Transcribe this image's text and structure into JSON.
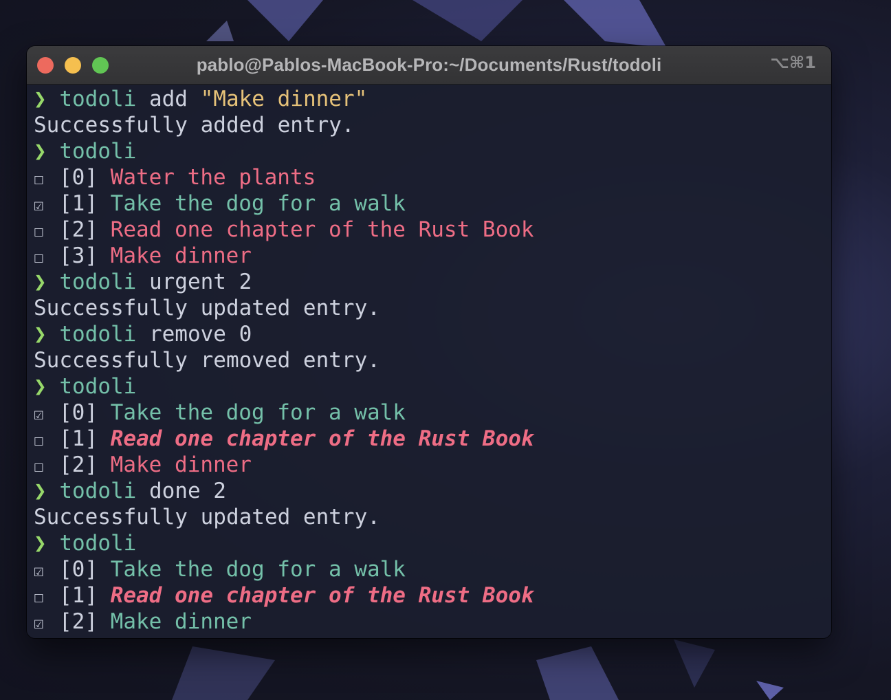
{
  "window": {
    "title": "pablo@Pablos-MacBook-Pro:~/Documents/Rust/todoli",
    "shortcut": "⌥⌘1"
  },
  "colors": {
    "prompt": "#97d86a",
    "command": "#74c0a9",
    "string": "#e6c279",
    "pending": "#ee6d85",
    "done": "#74c0a9",
    "text": "#cdd1de"
  },
  "prompt_symbol": "❯",
  "lines": [
    {
      "kind": "cmd",
      "cmd": "todoli",
      "args": " add ",
      "str": "\"Make dinner\""
    },
    {
      "kind": "out",
      "text": "Successfully added entry."
    },
    {
      "kind": "cmd",
      "cmd": "todoli",
      "args": "",
      "str": ""
    },
    {
      "kind": "item",
      "box": "☐",
      "idx": "[0]",
      "text": "Water the plants",
      "state": "pending"
    },
    {
      "kind": "item",
      "box": "☑",
      "idx": "[1]",
      "text": "Take the dog for a walk",
      "state": "done"
    },
    {
      "kind": "item",
      "box": "☐",
      "idx": "[2]",
      "text": "Read one chapter of the Rust Book",
      "state": "pending"
    },
    {
      "kind": "item",
      "box": "☐",
      "idx": "[3]",
      "text": "Make dinner",
      "state": "pending"
    },
    {
      "kind": "cmd",
      "cmd": "todoli",
      "args": " urgent 2",
      "str": ""
    },
    {
      "kind": "out",
      "text": "Successfully updated entry."
    },
    {
      "kind": "cmd",
      "cmd": "todoli",
      "args": " remove 0",
      "str": ""
    },
    {
      "kind": "out",
      "text": "Successfully removed entry."
    },
    {
      "kind": "cmd",
      "cmd": "todoli",
      "args": "",
      "str": ""
    },
    {
      "kind": "item",
      "box": "☑",
      "idx": "[0]",
      "text": "Take the dog for a walk",
      "state": "done"
    },
    {
      "kind": "item",
      "box": "☐",
      "idx": "[1]",
      "text": "Read one chapter of the Rust Book",
      "state": "urgent"
    },
    {
      "kind": "item",
      "box": "☐",
      "idx": "[2]",
      "text": "Make dinner",
      "state": "pending"
    },
    {
      "kind": "cmd",
      "cmd": "todoli",
      "args": " done 2",
      "str": ""
    },
    {
      "kind": "out",
      "text": "Successfully updated entry."
    },
    {
      "kind": "cmd",
      "cmd": "todoli",
      "args": "",
      "str": ""
    },
    {
      "kind": "item",
      "box": "☑",
      "idx": "[0]",
      "text": "Take the dog for a walk",
      "state": "done"
    },
    {
      "kind": "item",
      "box": "☐",
      "idx": "[1]",
      "text": "Read one chapter of the Rust Book",
      "state": "urgent"
    },
    {
      "kind": "item",
      "box": "☑",
      "idx": "[2]",
      "text": "Make dinner",
      "state": "done"
    }
  ]
}
